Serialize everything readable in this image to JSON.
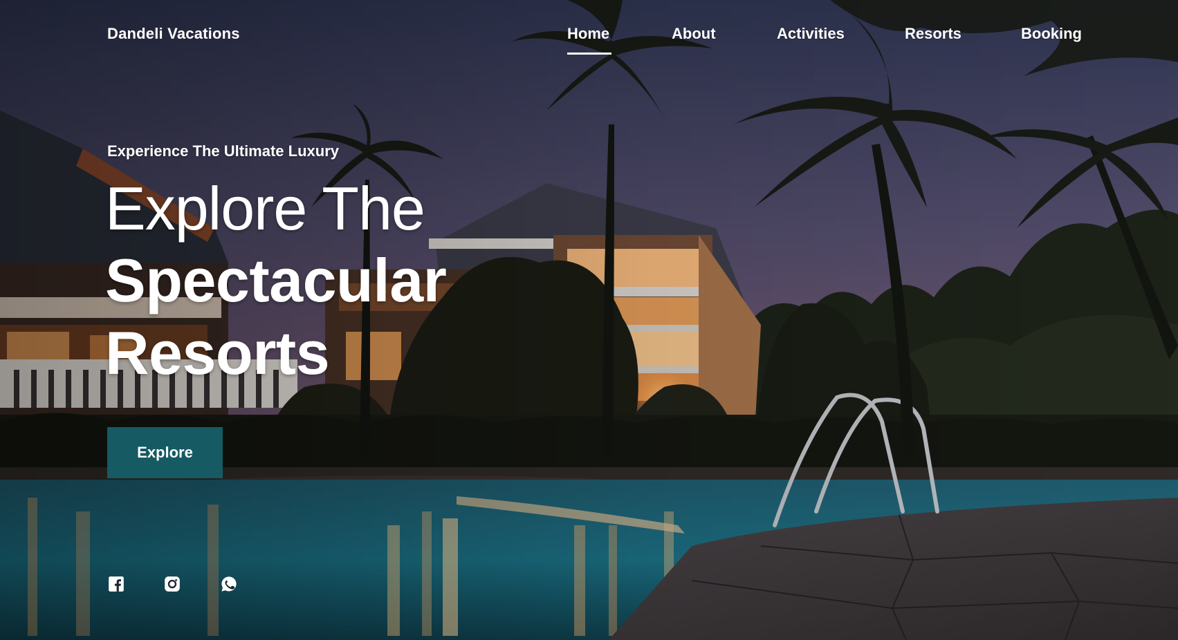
{
  "brand": {
    "name": "Dandeli Vacations"
  },
  "nav": {
    "active": "Home",
    "items": [
      {
        "label": "Home"
      },
      {
        "label": "About"
      },
      {
        "label": "Activities"
      },
      {
        "label": "Resorts"
      },
      {
        "label": "Booking"
      }
    ]
  },
  "hero": {
    "eyebrow": "Experience The Ultimate Luxury",
    "headline_line1": "Explore The",
    "headline_line2": "Spectacular",
    "headline_line3": "Resorts",
    "cta_label": "Explore"
  },
  "social": {
    "icons": [
      "facebook-icon",
      "instagram-icon",
      "whatsapp-icon"
    ]
  },
  "colors": {
    "accent_button": "#165a63",
    "text": "#ffffff"
  }
}
